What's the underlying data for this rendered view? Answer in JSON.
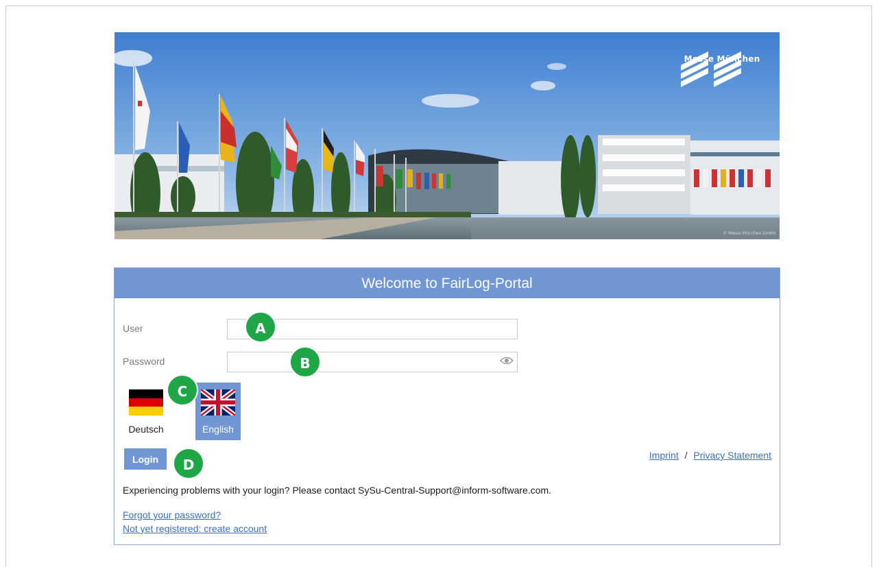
{
  "banner": {
    "logo_text": "Messe München",
    "copyright": "© Messe München GmbH"
  },
  "panel": {
    "title": "Welcome to FairLog-Portal",
    "user_label": "User",
    "user_value": "",
    "password_label": "Password",
    "password_value": "",
    "languages": [
      {
        "label": "Deutsch",
        "selected": false
      },
      {
        "label": "English",
        "selected": true
      }
    ],
    "login_label": "Login",
    "imprint_label": "Imprint",
    "separator": "/",
    "privacy_label": "Privacy Statement",
    "problem_text": "Experiencing problems with your login? Please contact SySu-Central-Support@inform-software.com.",
    "forgot_label": "Forgot your password?",
    "register_label": "Not yet registered: create account"
  },
  "markers": [
    "A",
    "B",
    "C",
    "D"
  ],
  "colors": {
    "accent": "#7096d4",
    "marker": "#1fa646",
    "link": "#3a6fbf"
  }
}
